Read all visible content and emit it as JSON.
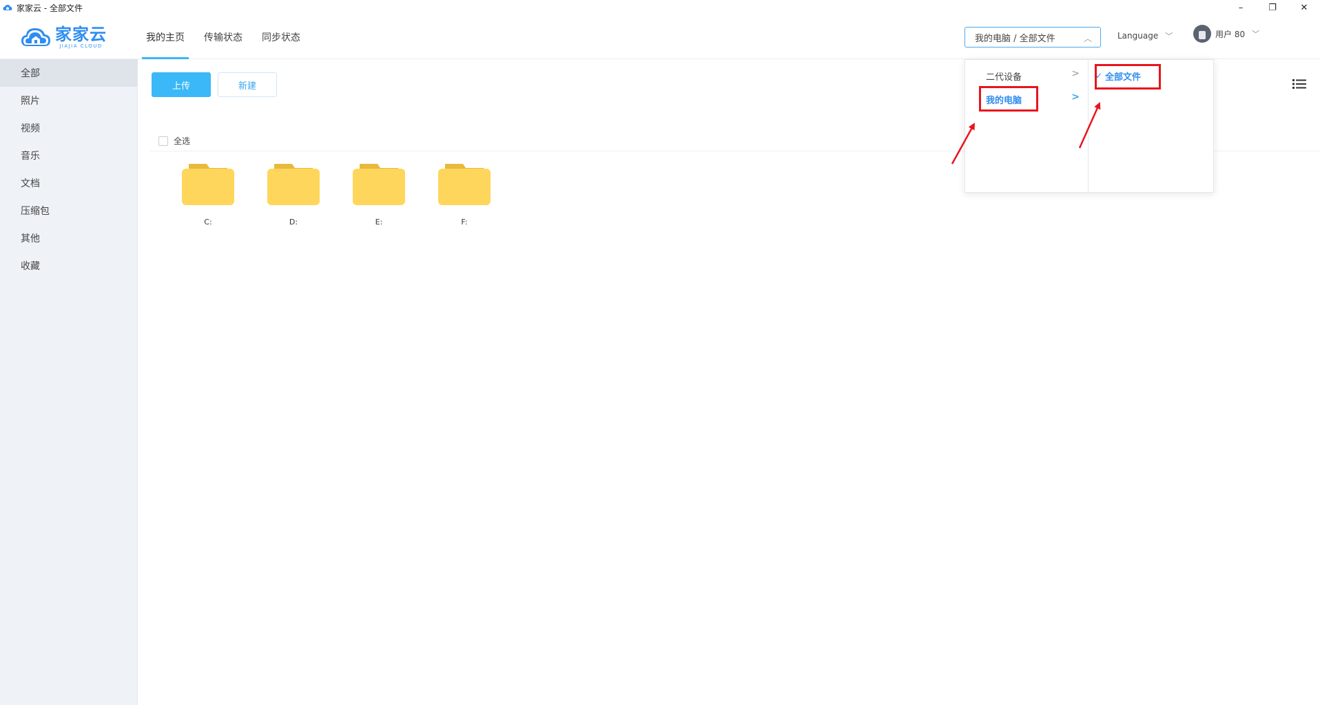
{
  "window": {
    "title": "家家云 - 全部文件",
    "controls": {
      "minimize": "–",
      "restore": "❐",
      "close": "✕"
    }
  },
  "header": {
    "logo": {
      "cn": "家家云",
      "en": "JIAJIA CLOUD"
    },
    "tabs": [
      {
        "label": "我的主页",
        "active": true
      },
      {
        "label": "传输状态",
        "active": false
      },
      {
        "label": "同步状态",
        "active": false
      }
    ],
    "path_select": {
      "value": "我的电脑 / 全部文件",
      "caret": "︿"
    },
    "language": {
      "label": "Language",
      "caret": "﹀"
    },
    "user": {
      "name": "用户 80",
      "caret": "﹀"
    }
  },
  "sidebar": {
    "items": [
      {
        "label": "全部",
        "active": true
      },
      {
        "label": "照片"
      },
      {
        "label": "视频"
      },
      {
        "label": "音乐"
      },
      {
        "label": "文档"
      },
      {
        "label": "压缩包"
      },
      {
        "label": "其他"
      },
      {
        "label": "收藏"
      }
    ]
  },
  "toolbar": {
    "upload_label": "上传",
    "new_label": "新建"
  },
  "list": {
    "select_all_label": "全选",
    "folders": [
      {
        "name": "C:"
      },
      {
        "name": "D:"
      },
      {
        "name": "E:"
      },
      {
        "name": "F:"
      }
    ]
  },
  "cascader": {
    "level1": [
      {
        "label": "二代设备",
        "arrow": ">"
      },
      {
        "label": "我的电脑",
        "arrow": ">",
        "active": true
      }
    ],
    "level2": [
      {
        "label": "全部文件",
        "check": "✓",
        "active": true
      }
    ]
  },
  "colors": {
    "accent": "#3bb8f7",
    "brand": "#2f8df0",
    "folder": "#ffd65c",
    "annotation": "#e8141c",
    "sidebar_bg": "#eff3f7"
  }
}
